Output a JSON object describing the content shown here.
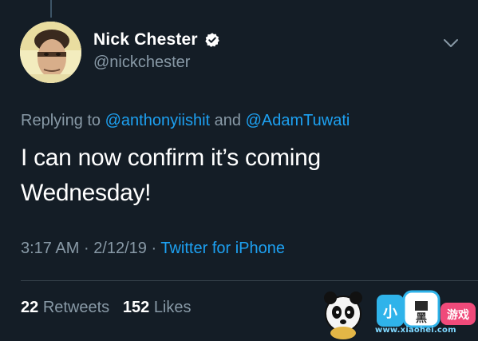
{
  "tweet": {
    "display_name": "Nick Chester",
    "handle": "@nickchester",
    "replying_prefix": "Replying to",
    "reply_to_1": "@anthonyiishit",
    "reply_joiner": "and",
    "reply_to_2": "@AdamTuwati",
    "text": "I can now confirm it’s coming Wednesday!",
    "time": "3:17 AM",
    "separator": "·",
    "date": "2/12/19",
    "source": "Twitter for iPhone",
    "retweets_count": "22",
    "retweets_label": "Retweets",
    "likes_count": "152",
    "likes_label": "Likes"
  },
  "icons": {
    "verified": "verified-badge-icon",
    "caret": "chevron-down-icon"
  },
  "watermark": {
    "logo_text": "小黑游戏",
    "url": "www.xiaohei.com"
  },
  "colors": {
    "background": "#141d26",
    "accent": "#1da1f2",
    "secondary_text": "#8899a6"
  }
}
